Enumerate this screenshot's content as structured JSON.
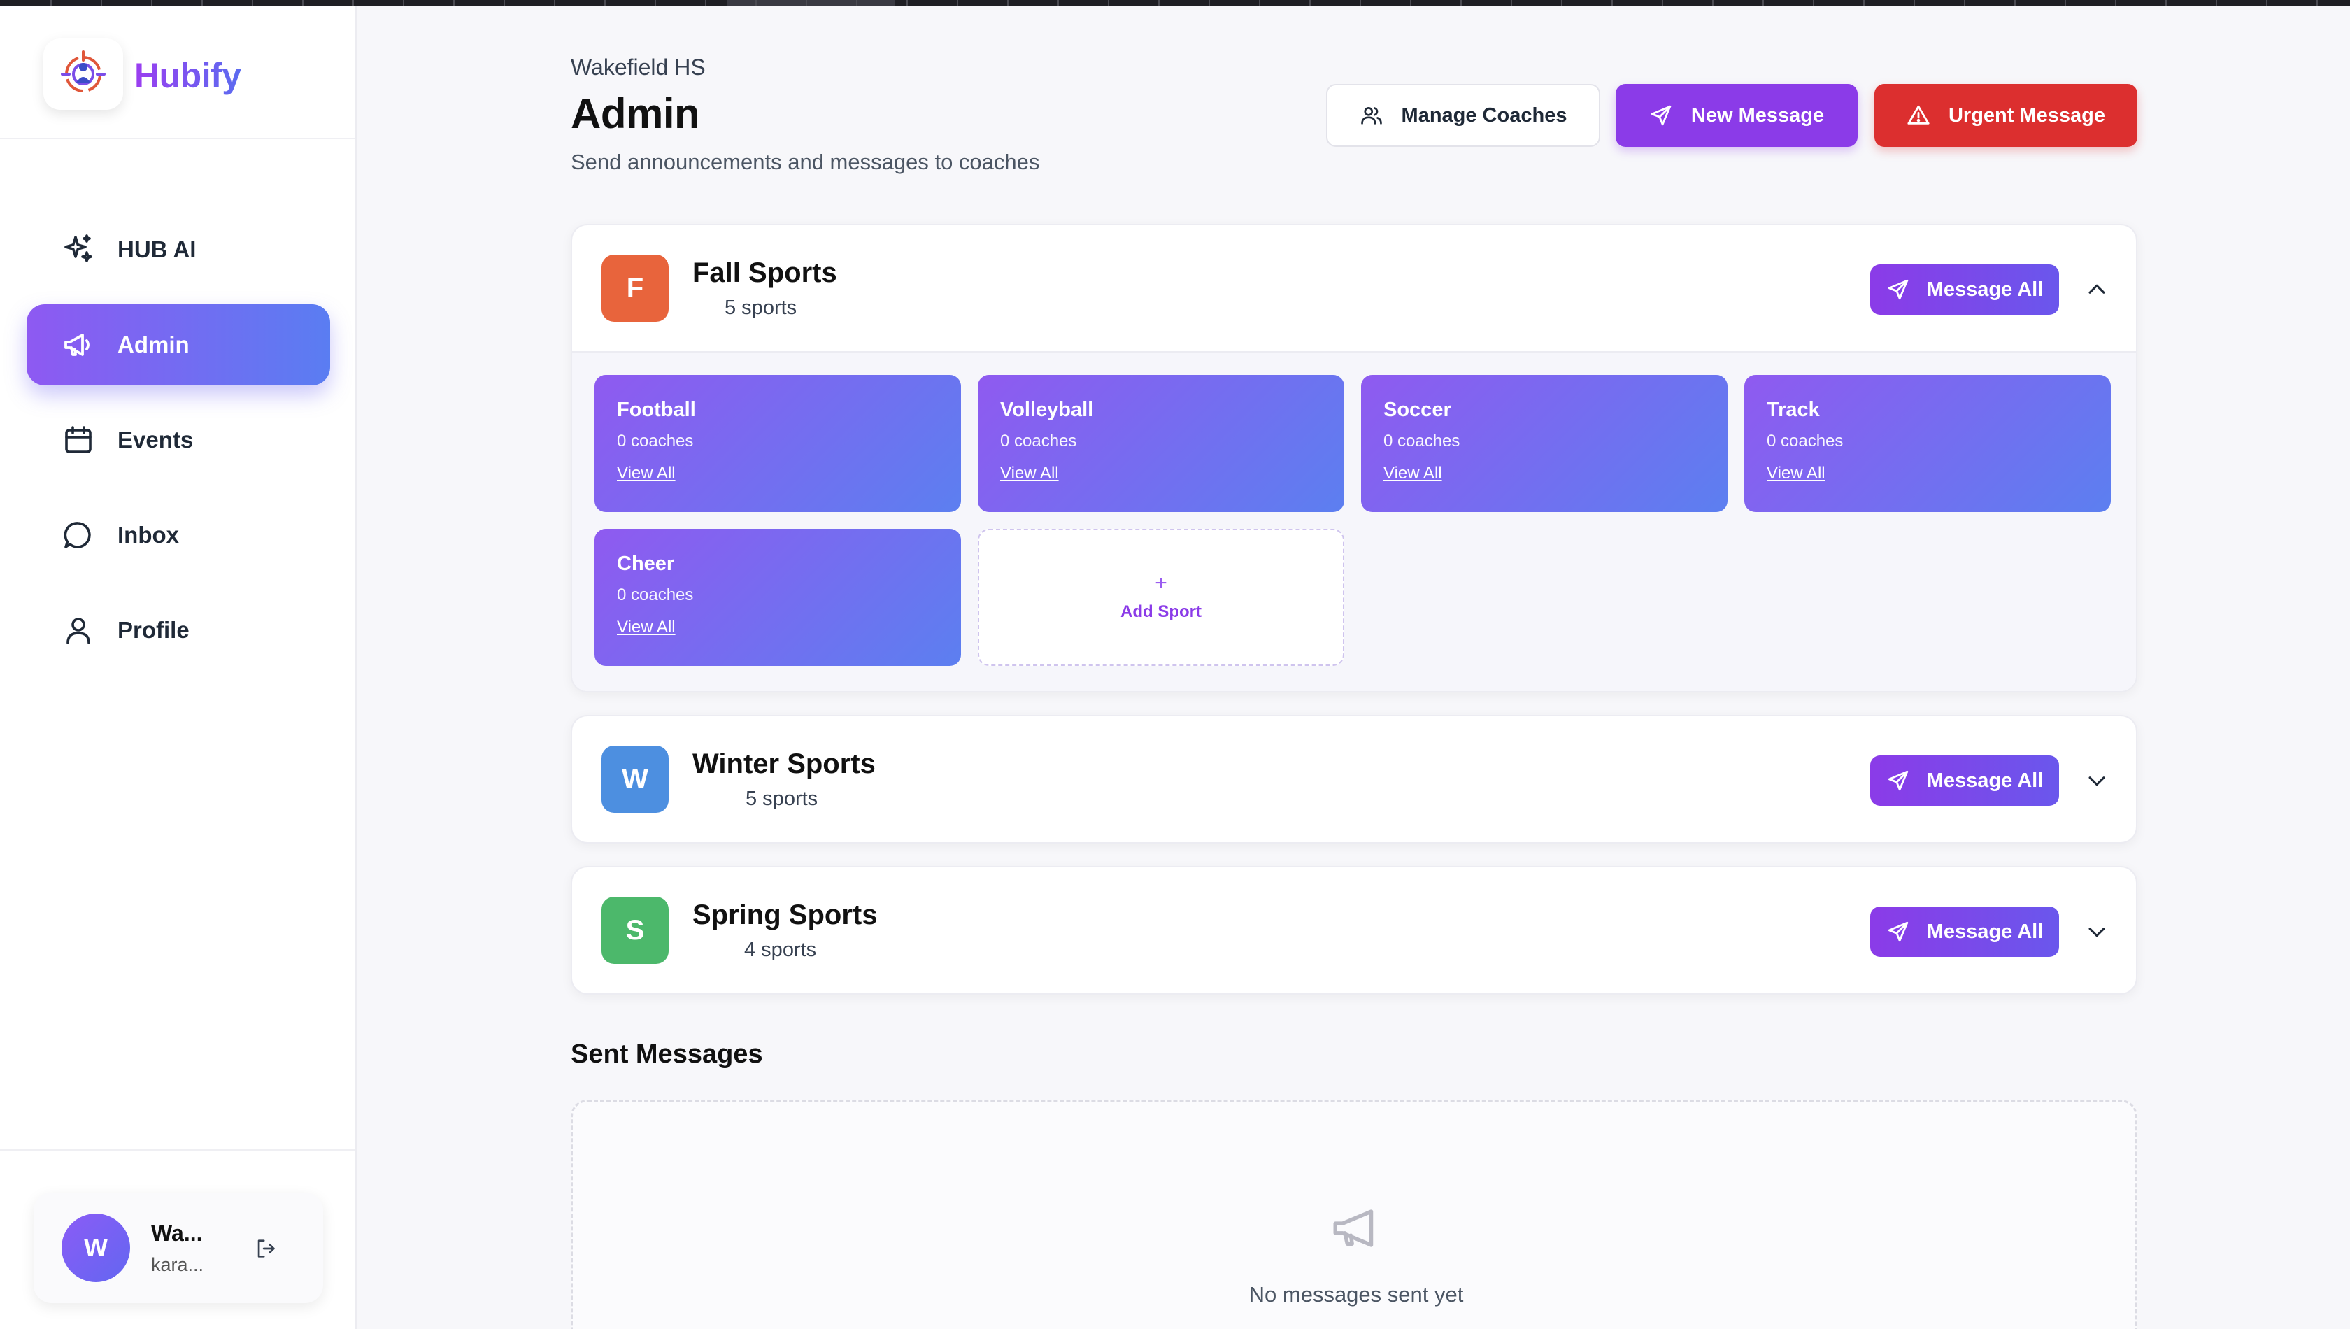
{
  "app": {
    "name": "Hubify"
  },
  "sidebar": {
    "items": [
      {
        "label": "HUB AI",
        "icon": "sparkles-icon"
      },
      {
        "label": "Admin",
        "icon": "megaphone-icon",
        "active": true
      },
      {
        "label": "Events",
        "icon": "calendar-icon"
      },
      {
        "label": "Inbox",
        "icon": "chat-bubble-icon"
      },
      {
        "label": "Profile",
        "icon": "user-icon"
      }
    ],
    "user": {
      "initial": "W",
      "name": "Wa...",
      "email": "kara..."
    }
  },
  "header": {
    "org": "Wakefield HS",
    "title": "Admin",
    "subtitle": "Send announcements and messages to coaches",
    "manage_coaches": "Manage Coaches",
    "new_message": "New Message",
    "urgent_message": "Urgent Message"
  },
  "seasons": [
    {
      "initial": "F",
      "name": "Fall Sports",
      "count": "5 sports",
      "color": "#e8643c",
      "message_all": "Message All",
      "expanded": true,
      "sports": [
        {
          "name": "Football",
          "coaches": "0 coaches",
          "link": "View All"
        },
        {
          "name": "Volleyball",
          "coaches": "0 coaches",
          "link": "View All"
        },
        {
          "name": "Soccer",
          "coaches": "0 coaches",
          "link": "View All"
        },
        {
          "name": "Track",
          "coaches": "0 coaches",
          "link": "View All"
        },
        {
          "name": "Cheer",
          "coaches": "0 coaches",
          "link": "View All"
        }
      ],
      "add_sport": {
        "plus": "+",
        "label": "Add Sport"
      }
    },
    {
      "initial": "W",
      "name": "Winter Sports",
      "count": "5 sports",
      "color": "#4d8fe0",
      "message_all": "Message All",
      "expanded": false
    },
    {
      "initial": "S",
      "name": "Spring Sports",
      "count": "4 sports",
      "color": "#4cb86b",
      "message_all": "Message All",
      "expanded": false
    }
  ],
  "sent": {
    "title": "Sent Messages",
    "empty_text": "No messages sent yet"
  },
  "colors": {
    "accent_purple": "#8b3be8",
    "urgent_red": "#dc2f2f",
    "nav_gradient_start": "#8e59f2",
    "nav_gradient_end": "#5a7df2"
  }
}
